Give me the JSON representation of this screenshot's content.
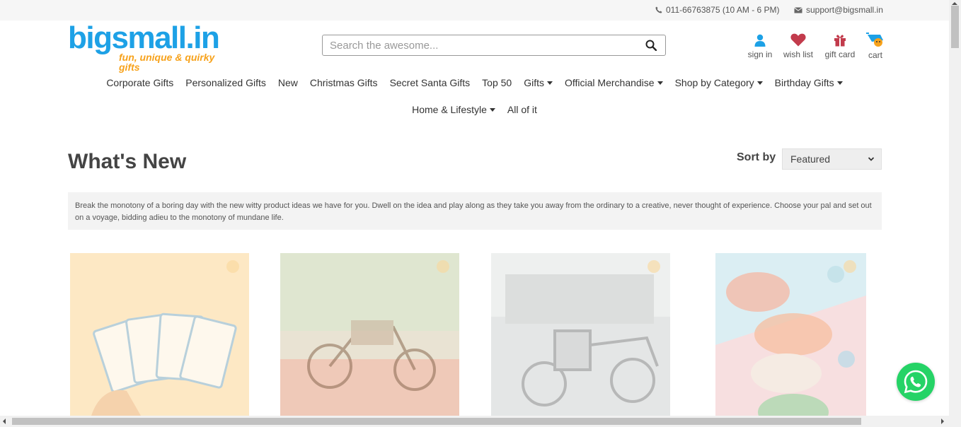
{
  "topbar": {
    "phone": "011-66763875 (10 AM - 6 PM)",
    "email": "support@bigsmall.in",
    "phone_icon": "phone-icon",
    "email_icon": "mail-icon"
  },
  "logo": {
    "brand": "bigsmall.in",
    "tagline": "fun, unique & quirky gifts"
  },
  "search": {
    "placeholder": "Search the awesome...",
    "value": "",
    "icon": "search-icon"
  },
  "header_actions": [
    {
      "label": "sign in",
      "icon": "user-icon"
    },
    {
      "label": "wish list",
      "icon": "heart-icon"
    },
    {
      "label": "gift card",
      "icon": "gift-icon"
    },
    {
      "label": "cart",
      "icon": "cart-icon"
    }
  ],
  "nav": {
    "row1": [
      {
        "label": "Corporate Gifts",
        "dropdown": false
      },
      {
        "label": "Personalized Gifts",
        "dropdown": false
      },
      {
        "label": "New",
        "dropdown": false
      },
      {
        "label": "Christmas Gifts",
        "dropdown": false
      },
      {
        "label": "Secret Santa Gifts",
        "dropdown": false
      },
      {
        "label": "Top 50",
        "dropdown": false
      },
      {
        "label": "Gifts",
        "dropdown": true
      },
      {
        "label": "Official Merchandise",
        "dropdown": true
      },
      {
        "label": "Shop by Category",
        "dropdown": true
      },
      {
        "label": "Birthday Gifts",
        "dropdown": true
      }
    ],
    "row2": [
      {
        "label": "Home & Lifestyle",
        "dropdown": true
      },
      {
        "label": "All of it",
        "dropdown": false
      }
    ]
  },
  "page": {
    "title": "What's New",
    "sort_label": "Sort by",
    "sort_selected": "Featured",
    "description": "Break the monotony of a boring day with the new witty product ideas we have for you. Dwell on the idea and play along as they take you away from the ordinary to a creative, never thought of experience. Choose your pal and set out on a voyage, bidding adieu to the monotony of mundane life."
  },
  "colors": {
    "brand_blue": "#1da1e6",
    "brand_orange": "#f7a21b",
    "whatsapp": "#25d366",
    "heart": "#c23b4c"
  }
}
